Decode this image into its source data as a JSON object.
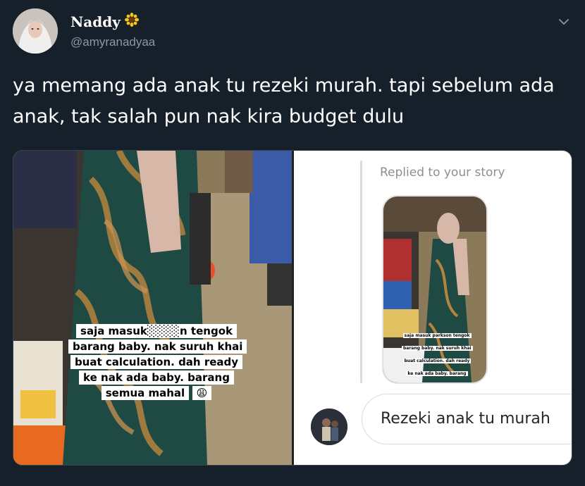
{
  "user": {
    "display_name": "Naddy",
    "handle": "@amyranadyaa"
  },
  "icons": {
    "name_badge": "sunflower-emoji",
    "menu": "chevron-down-icon",
    "caption_emoji": "weary-face-emoji"
  },
  "tweet": {
    "text": "ya memang ada anak tu rezeki murah. tapi sebelum ada anak, tak salah pun nak kira budget dulu"
  },
  "media": {
    "left_image": {
      "caption": "saja masuk░░░░n tengok barang baby. nak suruh khai buat calculation. dah ready ke nak ada baby. barang semua mahal"
    },
    "right_image": {
      "replied_label": "Replied to your story",
      "story_caption": "saja masuk parkson tengok barang baby. nak suruh khai buat calculation. dah ready ke nak ada baby. barang semua mahal",
      "reply_message": "Rezeki anak tu murah"
    }
  },
  "colors": {
    "background": "#15202b",
    "text": "#ffffff",
    "secondary_text": "#8899a6"
  }
}
